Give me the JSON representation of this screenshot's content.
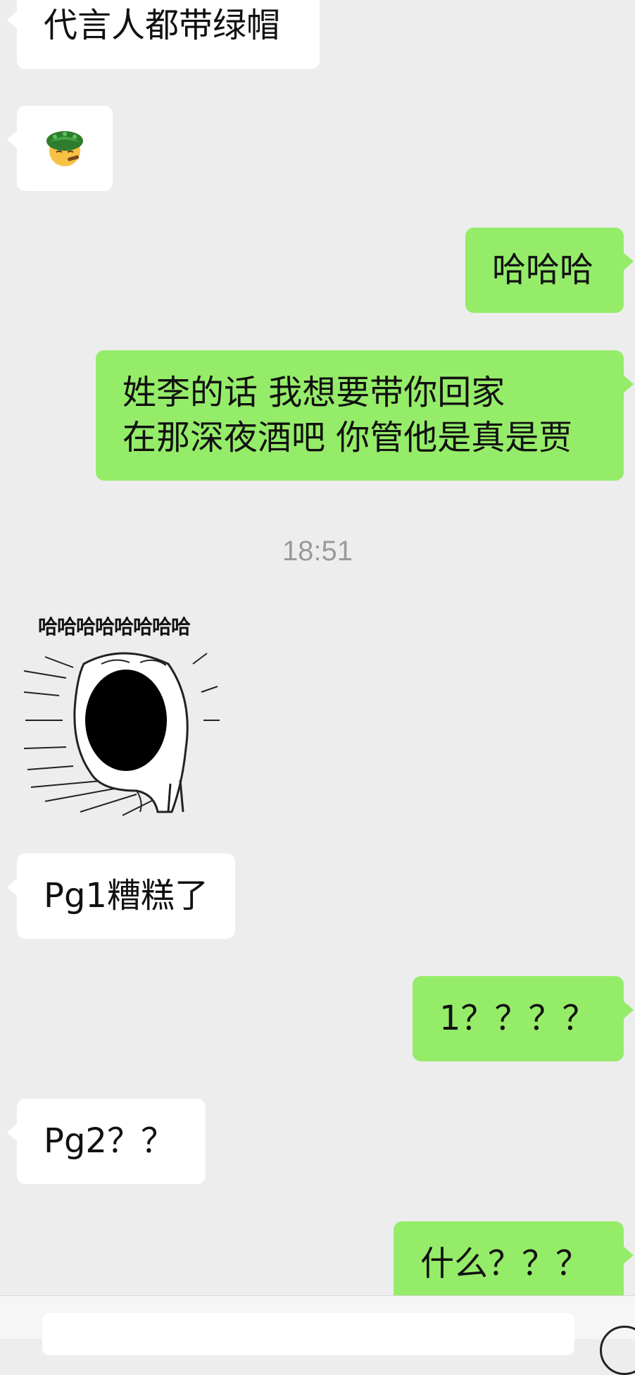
{
  "messages": [
    {
      "id": "m1",
      "side": "in",
      "text": "代言人都带绿帽"
    },
    {
      "id": "m2",
      "side": "in",
      "emoji": "green-hat-emoji"
    },
    {
      "id": "m3",
      "side": "out",
      "text": "哈哈哈"
    },
    {
      "id": "m4",
      "side": "out",
      "lines": [
        "姓李的话 我想要带你回家",
        "在那深夜酒吧 你管他是真是贾"
      ]
    },
    {
      "id": "m5",
      "side": "in",
      "sticker_caption": "哈哈哈哈哈哈哈哈"
    },
    {
      "id": "m6",
      "side": "in",
      "text": "Pg1糟糕了"
    },
    {
      "id": "m7",
      "side": "out",
      "text": "1？？？？"
    },
    {
      "id": "m8",
      "side": "in",
      "text": "Pg2？？"
    },
    {
      "id": "m9",
      "side": "out",
      "text": "什么？？？"
    }
  ],
  "timestamp": "18:51",
  "colors": {
    "background": "#ededed",
    "incoming_bubble": "#ffffff",
    "outgoing_bubble": "#95ec69",
    "timestamp_text": "#9a9a9a"
  },
  "icons": {
    "emoji": "green-hat-emoji",
    "voice_toggle": "voice-icon"
  }
}
